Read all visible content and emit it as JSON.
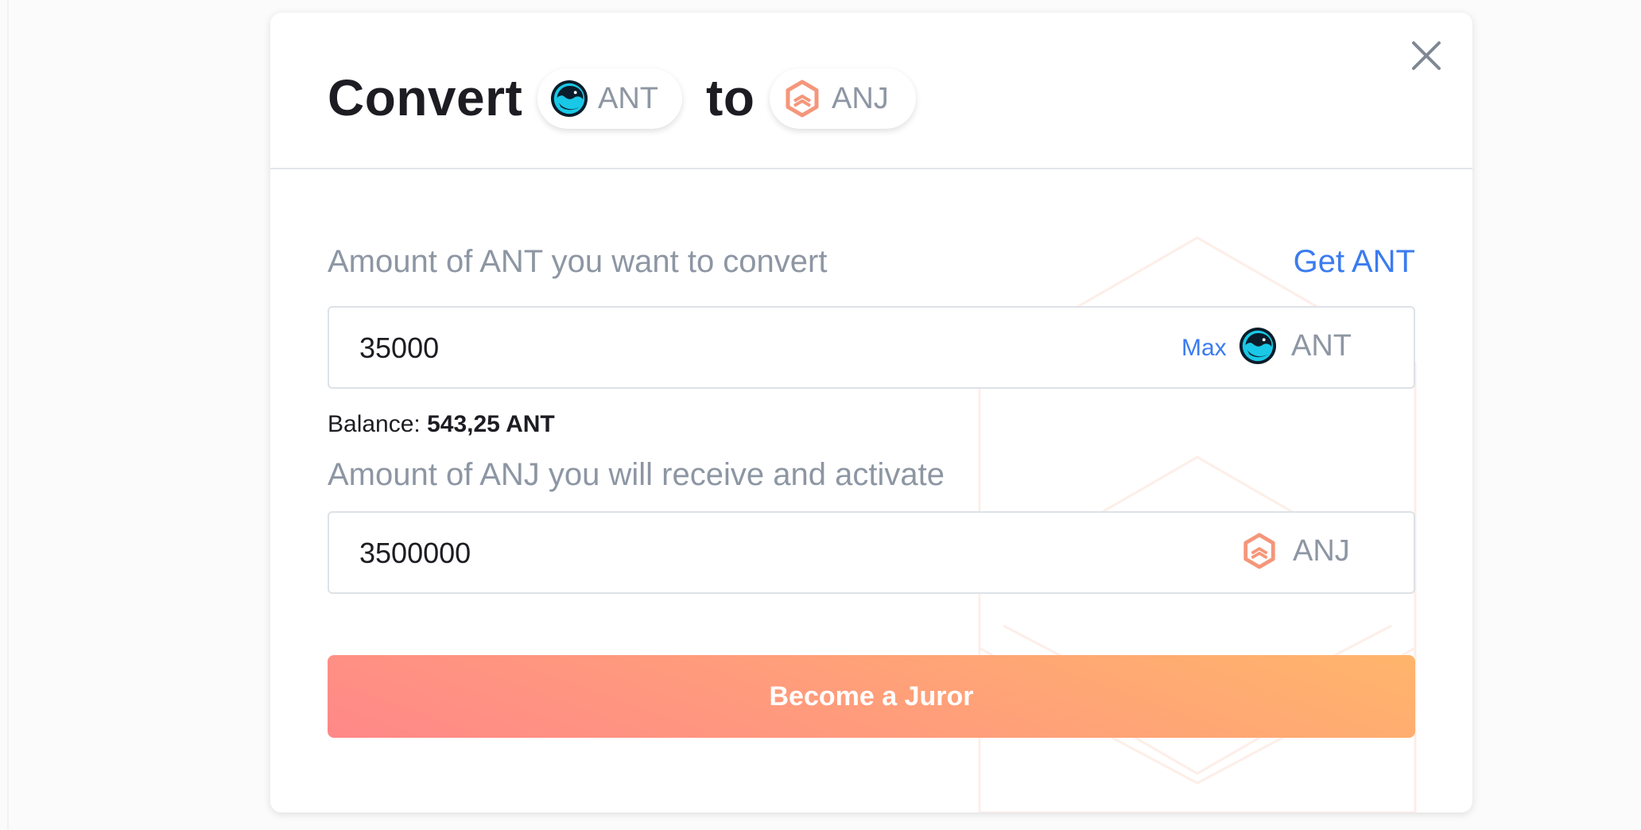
{
  "dialog": {
    "title_prefix": "Convert",
    "title_connector": "to",
    "from_token": {
      "symbol": "ANT",
      "icon": "aragon-ant-icon"
    },
    "to_token": {
      "symbol": "ANJ",
      "icon": "anj-hexagon-icon"
    }
  },
  "convert_form": {
    "from_label": "Amount of ANT you want to convert",
    "get_ant_link": "Get ANT",
    "from_amount": "35000",
    "max_label": "Max",
    "from_symbol": "ANT",
    "balance_label": "Balance:",
    "balance_value": "543,25 ANT",
    "to_label": "Amount of ANJ you will receive and activate",
    "to_amount": "3500000",
    "to_symbol": "ANJ",
    "submit_label": "Become a Juror"
  },
  "colors": {
    "link": "#3b7bf0",
    "muted_text": "#8d96a3",
    "cta_gradient_start": "#ffb56b",
    "cta_gradient_end": "#ff8888",
    "anj_orange": "#f5967a",
    "ant_cyan": "#19c8e6"
  }
}
